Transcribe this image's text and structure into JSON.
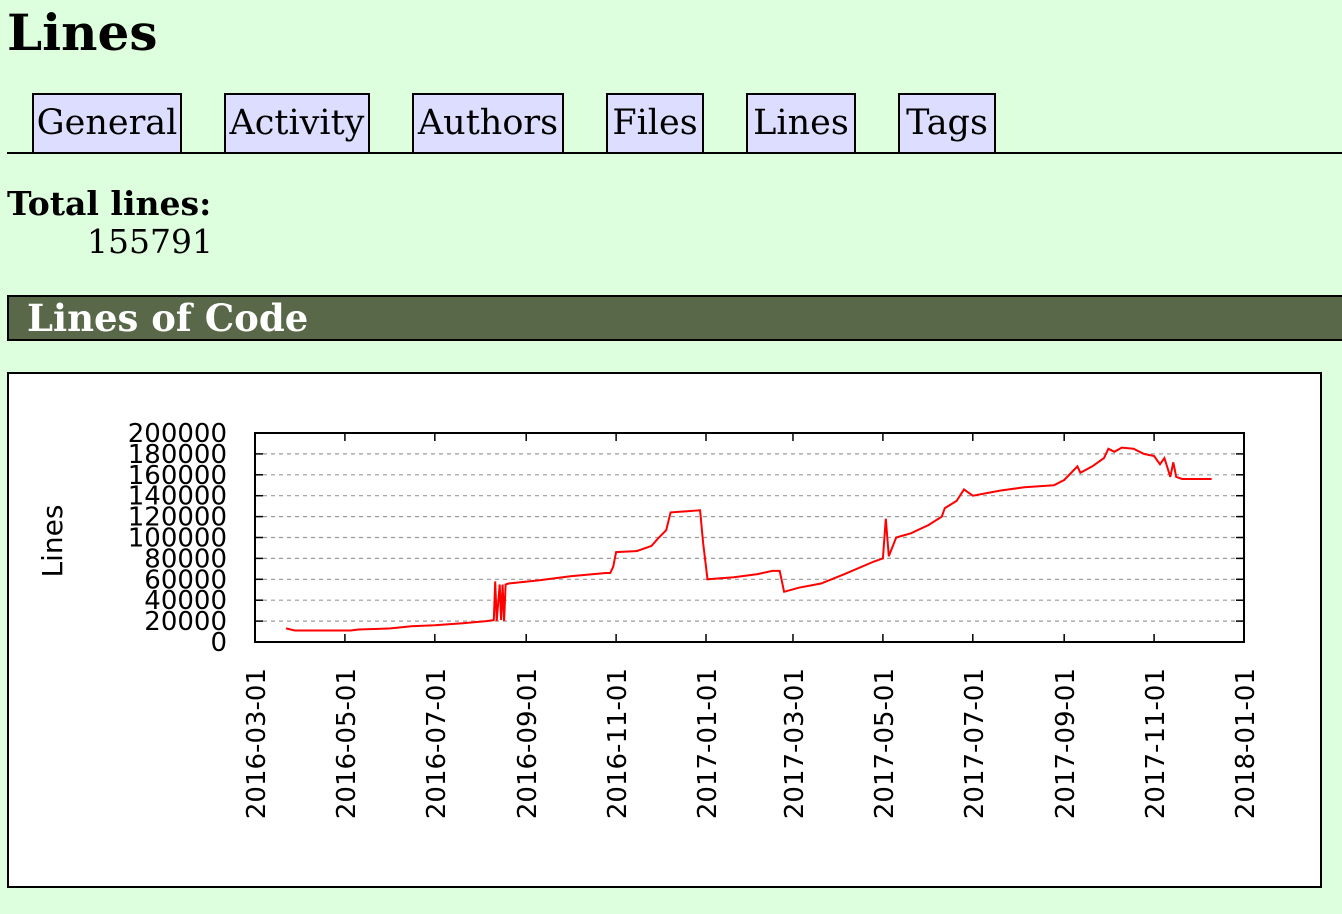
{
  "page": {
    "title": "Lines",
    "tabs": [
      {
        "label": "General"
      },
      {
        "label": "Activity"
      },
      {
        "label": "Authors"
      },
      {
        "label": "Files"
      },
      {
        "label": "Lines"
      },
      {
        "label": "Tags"
      }
    ],
    "total_lines_label": "Total lines:",
    "total_lines_value": "155791",
    "section_title": "Lines of Code"
  },
  "colors": {
    "background": "#ddffdd",
    "tab_bg": "#ddddff",
    "section_bg": "#586848",
    "series_line": "#ff0000"
  },
  "chart_data": {
    "type": "line",
    "title": "",
    "xlabel": "",
    "ylabel": "Lines",
    "xlim": [
      "2016-03-01",
      "2018-01-01"
    ],
    "ylim": [
      0,
      200000
    ],
    "yticks": [
      0,
      20000,
      40000,
      60000,
      80000,
      100000,
      120000,
      140000,
      160000,
      180000,
      200000
    ],
    "ytick_labels": [
      "0",
      "20000",
      "40000",
      "60000",
      "80000",
      "100000",
      "120000",
      "140000",
      "160000",
      "180000",
      "200000"
    ],
    "xtick_labels": [
      "2016-03-01",
      "2016-05-01",
      "2016-07-01",
      "2016-09-01",
      "2016-11-01",
      "2017-01-01",
      "2017-03-01",
      "2017-05-01",
      "2017-07-01",
      "2017-09-01",
      "2017-11-01",
      "2018-01-01"
    ],
    "grid": "horizontal dashed",
    "series": [
      {
        "color": "#ff0000",
        "points": [
          [
            "2016-03-22",
            13000
          ],
          [
            "2016-03-28",
            11000
          ],
          [
            "2016-04-10",
            11000
          ],
          [
            "2016-05-05",
            11000
          ],
          [
            "2016-05-10",
            12000
          ],
          [
            "2016-06-01",
            13000
          ],
          [
            "2016-06-15",
            15000
          ],
          [
            "2016-07-01",
            16000
          ],
          [
            "2016-07-20",
            18000
          ],
          [
            "2016-08-05",
            20000
          ],
          [
            "2016-08-10",
            21000
          ],
          [
            "2016-08-11",
            58000
          ],
          [
            "2016-08-12",
            20000
          ],
          [
            "2016-08-14",
            55000
          ],
          [
            "2016-08-15",
            21000
          ],
          [
            "2016-08-16",
            55000
          ],
          [
            "2016-08-17",
            20000
          ],
          [
            "2016-08-18",
            55000
          ],
          [
            "2016-08-20",
            56000
          ],
          [
            "2016-09-10",
            59000
          ],
          [
            "2016-10-01",
            63000
          ],
          [
            "2016-10-25",
            66000
          ],
          [
            "2016-10-28",
            66000
          ],
          [
            "2016-10-30",
            72000
          ],
          [
            "2016-11-01",
            86000
          ],
          [
            "2016-11-15",
            87000
          ],
          [
            "2016-11-25",
            92000
          ],
          [
            "2016-11-30",
            100000
          ],
          [
            "2016-12-05",
            107000
          ],
          [
            "2016-12-08",
            124000
          ],
          [
            "2016-12-18",
            125000
          ],
          [
            "2016-12-28",
            126000
          ],
          [
            "2016-12-30",
            95000
          ],
          [
            "2017-01-02",
            60000
          ],
          [
            "2017-01-20",
            62000
          ],
          [
            "2017-02-05",
            65000
          ],
          [
            "2017-02-15",
            68000
          ],
          [
            "2017-02-20",
            68000
          ],
          [
            "2017-02-23",
            48000
          ],
          [
            "2017-03-05",
            52000
          ],
          [
            "2017-03-20",
            56000
          ],
          [
            "2017-04-05",
            65000
          ],
          [
            "2017-04-25",
            77000
          ],
          [
            "2017-05-01",
            80000
          ],
          [
            "2017-05-03",
            118000
          ],
          [
            "2017-05-05",
            82000
          ],
          [
            "2017-05-10",
            100000
          ],
          [
            "2017-05-20",
            104000
          ],
          [
            "2017-06-01",
            112000
          ],
          [
            "2017-06-10",
            120000
          ],
          [
            "2017-06-12",
            128000
          ],
          [
            "2017-06-20",
            135000
          ],
          [
            "2017-06-25",
            146000
          ],
          [
            "2017-07-01",
            140000
          ],
          [
            "2017-07-20",
            145000
          ],
          [
            "2017-08-05",
            148000
          ],
          [
            "2017-08-25",
            150000
          ],
          [
            "2017-09-01",
            155000
          ],
          [
            "2017-09-10",
            168000
          ],
          [
            "2017-09-12",
            162000
          ],
          [
            "2017-09-20",
            168000
          ],
          [
            "2017-09-28",
            176000
          ],
          [
            "2017-10-01",
            185000
          ],
          [
            "2017-10-05",
            182000
          ],
          [
            "2017-10-10",
            186000
          ],
          [
            "2017-10-18",
            185000
          ],
          [
            "2017-10-25",
            180000
          ],
          [
            "2017-11-01",
            178000
          ],
          [
            "2017-11-05",
            170000
          ],
          [
            "2017-11-08",
            176000
          ],
          [
            "2017-11-10",
            167000
          ],
          [
            "2017-11-12",
            158000
          ],
          [
            "2017-11-14",
            172000
          ],
          [
            "2017-11-16",
            158000
          ],
          [
            "2017-11-20",
            156000
          ],
          [
            "2017-12-10",
            156000
          ]
        ]
      }
    ]
  }
}
